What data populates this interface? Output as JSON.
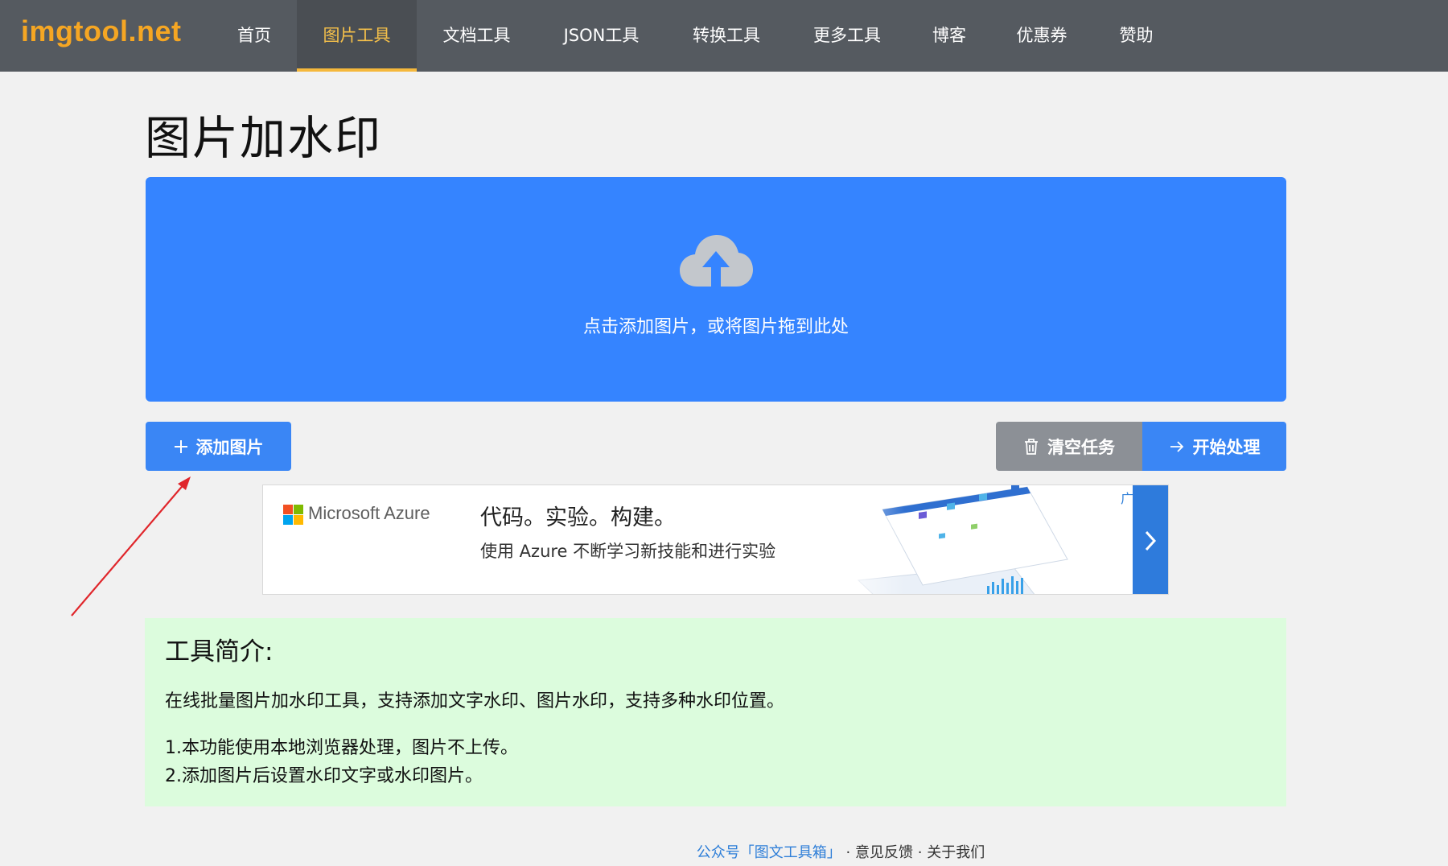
{
  "nav": {
    "logo": "imgtool.net",
    "items": [
      {
        "label": "首页"
      },
      {
        "label": "图片工具"
      },
      {
        "label": "文档工具"
      },
      {
        "label": "JSON工具"
      },
      {
        "label": "转换工具"
      },
      {
        "label": "更多工具"
      },
      {
        "label": "博客"
      },
      {
        "label": "优惠券"
      },
      {
        "label": "赞助"
      }
    ],
    "active_index": 1,
    "accent_color": "#f5b83c"
  },
  "page": {
    "title": "图片加水印"
  },
  "upload": {
    "icon": "cloud-upload-icon",
    "hint": "点击添加图片，或将图片拖到此处",
    "background_color": "#3584ff"
  },
  "actions": {
    "add_label": "添加图片",
    "clear_label": "清空任务",
    "start_label": "开始处理"
  },
  "ad": {
    "brand": "Microsoft Azure",
    "headline": "代码。实验。构建。",
    "subline": "使用 Azure 不断学习新技能和进行实验",
    "tag": "广告"
  },
  "intro": {
    "title": "工具简介:",
    "description": "在线批量图片加水印工具，支持添加文字水印、图片水印，支持多种水印位置。",
    "items": [
      "1.本功能使用本地浏览器处理，图片不上传。",
      "2.添加图片后设置水印文字或水印图片。"
    ]
  },
  "footer": {
    "wechat": "公众号「图文工具箱」",
    "separator": "·",
    "feedback": "意见反馈",
    "about": "关于我们"
  }
}
